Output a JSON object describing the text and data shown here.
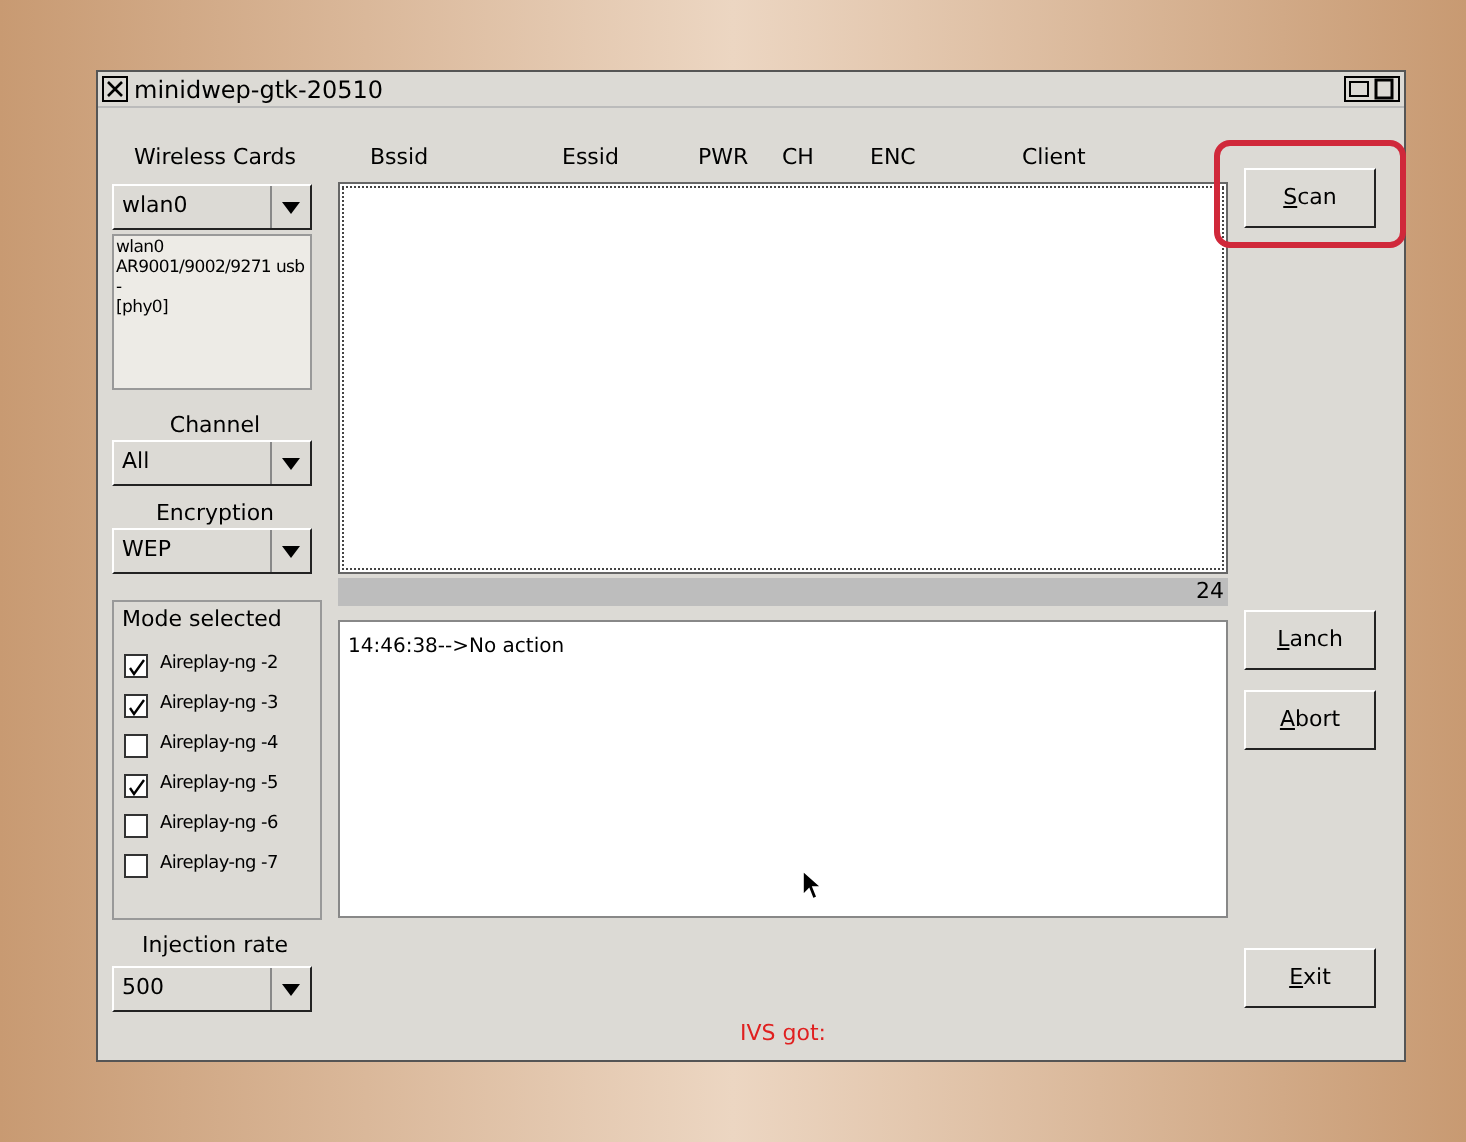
{
  "window": {
    "title": "minidwep-gtk-20510"
  },
  "wireless_cards": {
    "label": "Wireless Cards",
    "value": "wlan0",
    "info": [
      "wlan0",
      "AR9001/9002/9271 usb -",
      "[phy0]"
    ]
  },
  "channel": {
    "label": "Channel",
    "value": "All"
  },
  "encryption": {
    "label": "Encryption",
    "value": "WEP"
  },
  "mode_selected": {
    "label": "Mode selected",
    "options": [
      {
        "label": "Aireplay-ng -2",
        "checked": true
      },
      {
        "label": "Aireplay-ng -3",
        "checked": true
      },
      {
        "label": "Aireplay-ng -4",
        "checked": false
      },
      {
        "label": "Aireplay-ng -5",
        "checked": true
      },
      {
        "label": "Aireplay-ng -6",
        "checked": false
      },
      {
        "label": "Aireplay-ng -7",
        "checked": false
      }
    ]
  },
  "injection_rate": {
    "label": "Injection rate",
    "value": "500"
  },
  "table": {
    "columns": [
      "Bssid",
      "Essid",
      "PWR",
      "CH",
      "ENC",
      "Client"
    ]
  },
  "count": "24",
  "log": [
    "14:46:38-->No action"
  ],
  "ivs_label": "IVS got:",
  "buttons": {
    "scan": "Scan",
    "lanch": "Lanch",
    "abort": "Abort",
    "exit": "Exit"
  },
  "scan_highlighted": true
}
